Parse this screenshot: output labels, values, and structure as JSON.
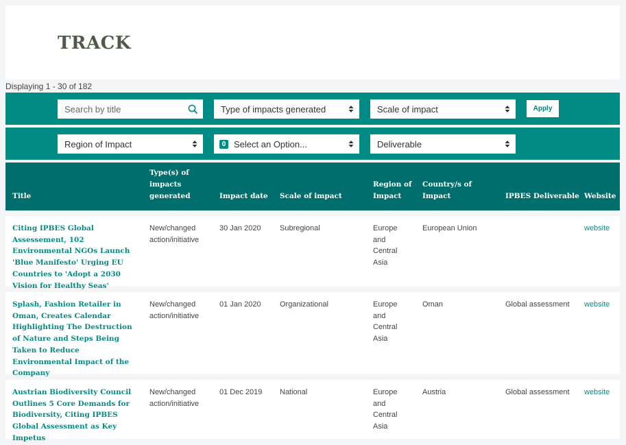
{
  "page": {
    "title": "TRACK",
    "displaying": "Displaying 1 - 30 of 182"
  },
  "filters": {
    "search_placeholder": "Search by title",
    "type_of_impacts": "Type of impacts generated",
    "scale_of_impact": "Scale of impact",
    "apply_label": "Apply",
    "region_of_impact": "Region of Impact",
    "select_badge": "0",
    "select_option": "Select an Option...",
    "deliverable": "Deliverable"
  },
  "table": {
    "headers": {
      "title": "Title",
      "types": "Type(s) of impacts generated",
      "impact_date": "Impact date",
      "scale": "Scale of impact",
      "region": "Region of Impact",
      "country": "Country/s of Impact",
      "deliverable": "IPBES Deliverable",
      "website": "Website"
    },
    "rows": [
      {
        "title": "Citing IPBES Global Assessement, 102 Environmental NGOs Launch 'Blue Manifesto' Urging EU Countries to 'Adopt a 2030 Vision for Healthy Seas'",
        "types": "New/changed action/initiative",
        "date": "30 Jan 2020",
        "scale": "Subregional",
        "region": "Europe and Central Asia",
        "country": "European Union",
        "deliverable": "",
        "website": "website"
      },
      {
        "title": "Splash, Fashion Retailer in Oman, Creates Calendar Highlighting The Destruction of Nature and Steps Being Taken to Reduce Environmental Impact of the Company",
        "types": "New/changed action/initiative",
        "date": "01 Jan 2020",
        "scale": "Organizational",
        "region": "Europe and Central Asia",
        "country": "Oman",
        "deliverable": "Global assessment",
        "website": "website"
      },
      {
        "title": "Austrian Biodiversity Council Outlines 5 Core Demands for Biodiversity, Citing IPBES Global Assessment as Key Impetus",
        "types": "New/changed action/initiative",
        "date": "01 Dec 2019",
        "scale": "National",
        "region": "Europe and Central Asia",
        "country": "Austria",
        "deliverable": "Global assessment",
        "website": "website"
      }
    ]
  },
  "colors": {
    "teal": "#008b85",
    "header_teal": "#006e6c",
    "link": "#0a8a84"
  }
}
